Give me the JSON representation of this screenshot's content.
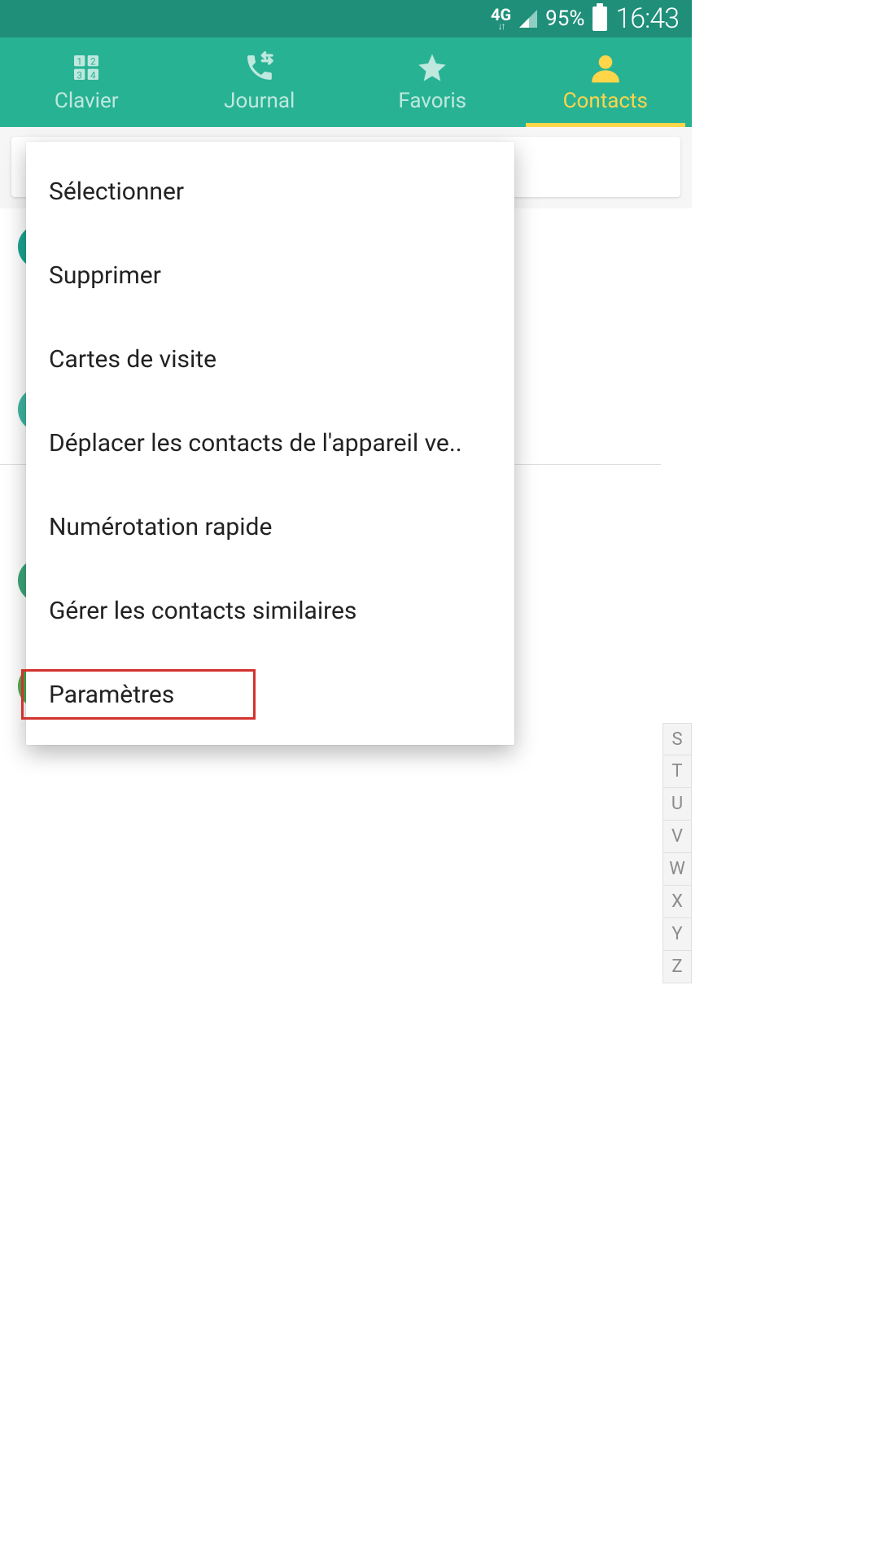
{
  "status": {
    "network": "4G",
    "battery_pct": "95%",
    "clock": "16:43"
  },
  "tabs": [
    {
      "id": "keypad",
      "label": "Clavier",
      "icon": "keypad-icon",
      "active": false
    },
    {
      "id": "log",
      "label": "Journal",
      "icon": "call-log-icon",
      "active": false
    },
    {
      "id": "fav",
      "label": "Favoris",
      "icon": "star-icon",
      "active": false
    },
    {
      "id": "contacts",
      "label": "Contacts",
      "icon": "person-icon",
      "active": true
    }
  ],
  "menu": {
    "items": [
      "Sélectionner",
      "Supprimer",
      "Cartes de visite",
      "Déplacer les contacts de l'appareil ve..",
      "Numérotation rapide",
      "Gérer les contacts similaires",
      "Paramètres"
    ]
  },
  "alpha_index": [
    "S",
    "T",
    "U",
    "V",
    "W",
    "X",
    "Y",
    "Z"
  ],
  "highlight": {
    "target_index": 6
  },
  "colors": {
    "primary": "#28b294",
    "primary_dark": "#1f8f7a",
    "accent": "#ffd54a",
    "highlight": "#d2322d"
  }
}
